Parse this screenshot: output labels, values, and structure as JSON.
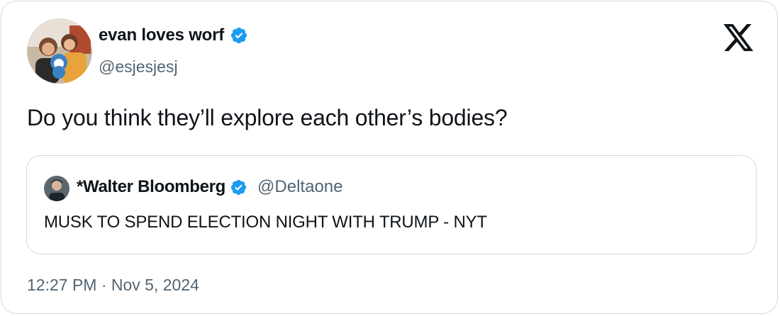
{
  "colors": {
    "verified_blue": "#1d9bf0",
    "text_primary": "#0f1419",
    "text_secondary": "#536471",
    "border": "#cfd9de"
  },
  "tweet": {
    "author": {
      "display_name": "evan loves worf",
      "handle": "@esjesjesj",
      "verified": true,
      "avatar_icon": "avatar-photo"
    },
    "text": "Do you think they’ll explore each other’s bodies?",
    "timestamp": "12:27 PM · Nov 5, 2024"
  },
  "quoted_tweet": {
    "author": {
      "display_name": "*Walter Bloomberg",
      "handle": "@Deltaone",
      "verified": true,
      "avatar_icon": "avatar-photo"
    },
    "text": "MUSK TO SPEND ELECTION NIGHT WITH TRUMP - NYT"
  },
  "brand": {
    "icon": "x-logo-icon"
  }
}
